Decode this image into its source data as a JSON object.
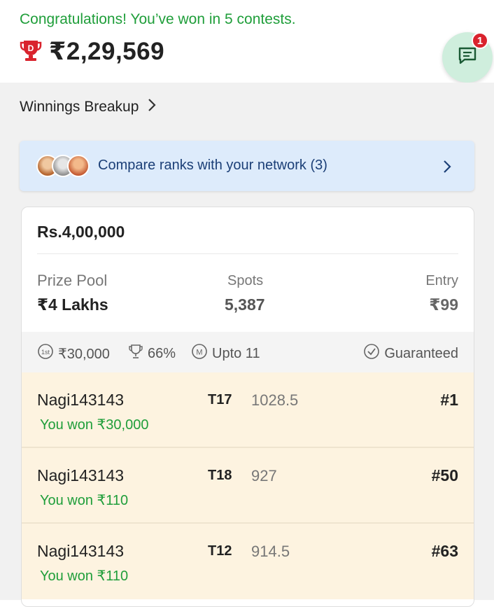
{
  "header": {
    "congrats_text": "Congratulations! You’ve won in 5 contests.",
    "total_winnings": "₹2,29,569",
    "chat_badge_count": "1"
  },
  "breakup": {
    "label": "Winnings Breakup"
  },
  "compare": {
    "label": "Compare ranks with your network (3)"
  },
  "contest": {
    "title": "Rs.4,00,000",
    "prize_pool_label": "Prize Pool",
    "prize_pool_value": "₹4 Lakhs",
    "spots_label": "Spots",
    "spots_value": "5,387",
    "entry_label": "Entry",
    "entry_value": "₹99",
    "first_prize": "₹30,000",
    "win_percent": "66%",
    "max_entries": "Upto 11",
    "guaranteed": "Guaranteed"
  },
  "teams": [
    {
      "name": "Nagi143143",
      "won": "You won ₹30,000",
      "team": "T17",
      "points": "1028.5",
      "rank": "#1"
    },
    {
      "name": "Nagi143143",
      "won": "You won ₹110",
      "team": "T18",
      "points": "927",
      "rank": "#50"
    },
    {
      "name": "Nagi143143",
      "won": "You won ₹110",
      "team": "T12",
      "points": "914.5",
      "rank": "#63"
    }
  ],
  "colors": {
    "win_green": "#1f9e3a",
    "compare_bg": "#ddebfb",
    "row_bg": "#fdf3e0",
    "badge_red": "#d9232d",
    "trophy_red": "#d9232d"
  },
  "icons": [
    "trophy-icon",
    "chat-icon",
    "chevron-right-icon",
    "first-prize-icon",
    "cup-icon",
    "multi-entry-icon",
    "guaranteed-check-icon"
  ]
}
